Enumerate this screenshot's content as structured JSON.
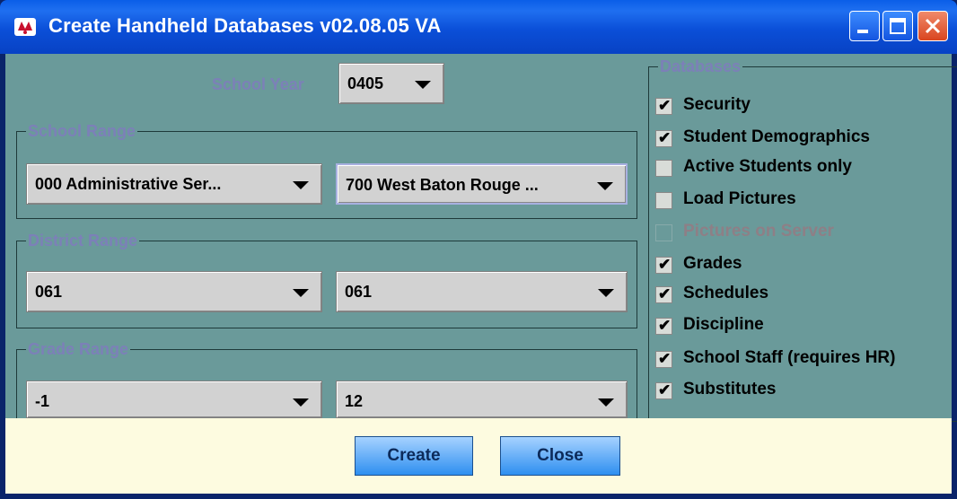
{
  "window": {
    "title": "Create Handheld Databases   v02.08.05 VA",
    "icon": "app-logo-icon",
    "controls": {
      "minimize": "minimize-icon",
      "maximize": "maximize-icon",
      "close": "close-icon"
    }
  },
  "school_year": {
    "label": "School Year",
    "value": "0405"
  },
  "school_range": {
    "legend": "School Range",
    "from": "000 Administrative Ser...",
    "to": "700 West Baton Rouge ..."
  },
  "district_range": {
    "legend": "District Range",
    "from": "061",
    "to": "061"
  },
  "grade_range": {
    "legend": "Grade Range",
    "from": "-1",
    "to": "12"
  },
  "databases": {
    "legend": "Databases",
    "items": [
      {
        "label": "Security",
        "checked": true,
        "enabled": true
      },
      {
        "label": "Student Demographics",
        "checked": true,
        "enabled": true
      },
      {
        "label": "Active Students only",
        "checked": false,
        "enabled": true
      },
      {
        "label": "Load Pictures",
        "checked": false,
        "enabled": true
      },
      {
        "label": "Pictures on Server",
        "checked": false,
        "enabled": false
      },
      {
        "label": "Grades",
        "checked": true,
        "enabled": true
      },
      {
        "label": "Schedules",
        "checked": true,
        "enabled": true
      },
      {
        "label": "Discipline",
        "checked": true,
        "enabled": true
      },
      {
        "label": "School Staff (requires HR)",
        "checked": true,
        "enabled": true
      },
      {
        "label": "Substitutes",
        "checked": true,
        "enabled": true
      }
    ],
    "check_glyph": "✔"
  },
  "buttons": {
    "create": "Create",
    "close": "Close"
  },
  "colors": {
    "panel": "#6a9a9a",
    "legend_text": "#7c80b8",
    "footer": "#fdfbe0",
    "title_bar": "#0b4fd8"
  }
}
